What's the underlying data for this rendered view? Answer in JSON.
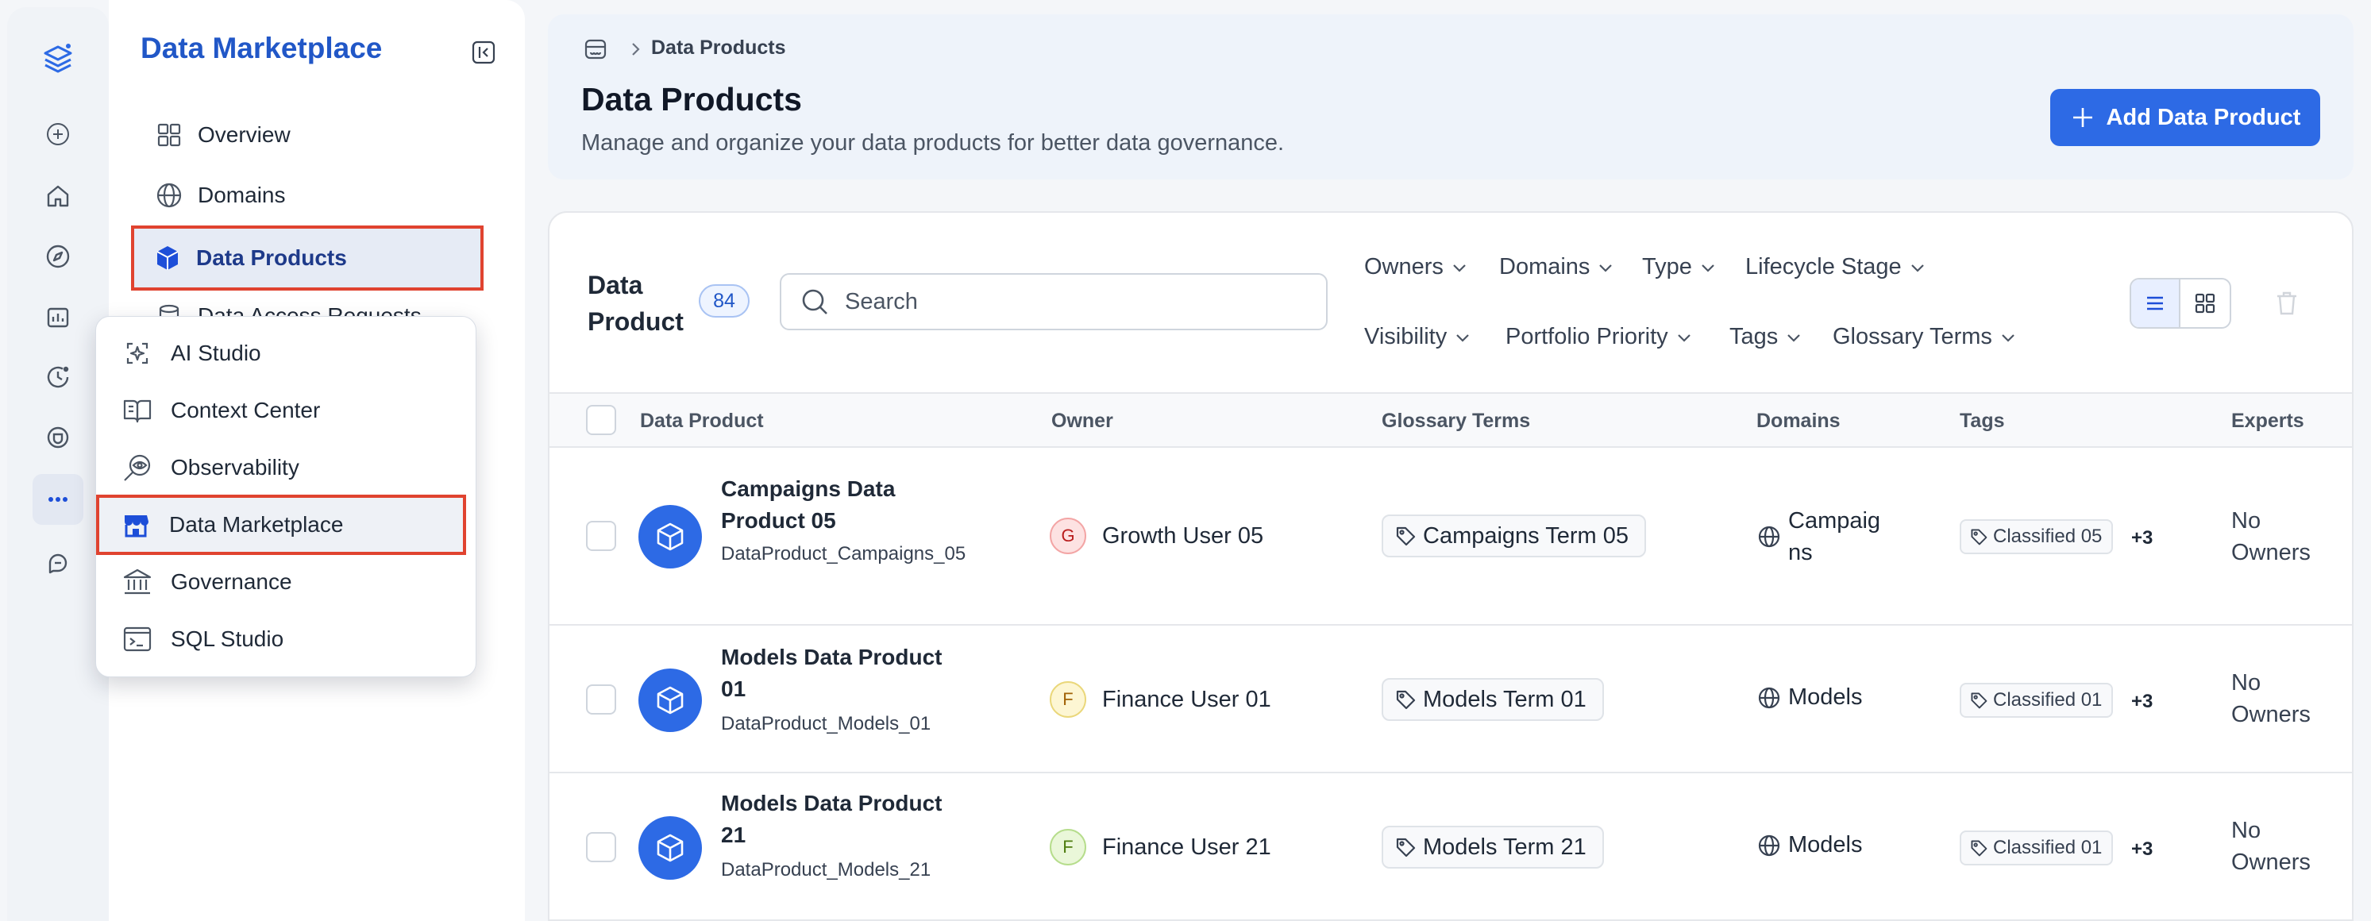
{
  "sidebar": {
    "title": "Data Marketplace",
    "items": [
      {
        "label": "Overview"
      },
      {
        "label": "Domains"
      },
      {
        "label": "Data Products"
      },
      {
        "label": "Data Access Requests"
      }
    ]
  },
  "popup_menu": {
    "items": [
      {
        "label": "AI Studio"
      },
      {
        "label": "Context Center"
      },
      {
        "label": "Observability"
      },
      {
        "label": "Data Marketplace"
      },
      {
        "label": "Governance"
      },
      {
        "label": "SQL Studio"
      }
    ]
  },
  "header": {
    "breadcrumb_current": "Data Products",
    "title": "Data Products",
    "subtitle": "Manage and organize your data products for better data governance.",
    "add_button_label": "Add Data Product"
  },
  "table": {
    "title": "Data Product",
    "count": "84",
    "search_placeholder": "Search",
    "filters": [
      "Owners",
      "Domains",
      "Type",
      "Lifecycle Stage",
      "Visibility",
      "Portfolio Priority",
      "Tags",
      "Glossary Terms"
    ],
    "columns": [
      "Data Product",
      "Owner",
      "Glossary Terms",
      "Domains",
      "Tags",
      "Experts"
    ],
    "rows": [
      {
        "name": "Campaigns Data Product 05",
        "id": "DataProduct_Campaigns_05",
        "owner_initial": "G",
        "owner": "Growth User 05",
        "glossary_term": "Campaigns Term 05",
        "domain": "Campaigns",
        "tag": "Classified 05",
        "tag_more": "+3",
        "experts": "No Owners"
      },
      {
        "name": "Models Data Product 01",
        "id": "DataProduct_Models_01",
        "owner_initial": "F",
        "owner": "Finance User 01",
        "glossary_term": "Models Term 01",
        "domain": "Models",
        "tag": "Classified 01",
        "tag_more": "+3",
        "experts": "No Owners"
      },
      {
        "name": "Models Data Product 21",
        "id": "DataProduct_Models_21",
        "owner_initial": "F",
        "owner": "Finance User 21",
        "glossary_term": "Models Term 21",
        "domain": "Models",
        "tag": "Classified 01",
        "tag_more": "+3",
        "experts": "No Owners"
      }
    ]
  },
  "colors": {
    "accent": "#2d6ae5",
    "highlight_outline": "#e04330",
    "avatar_growth_bg": "#fde2e2",
    "avatar_growth_fg": "#b91c1c",
    "avatar_finance_bg": "#fdf6d3",
    "avatar_finance_fg": "#a16207",
    "avatar_finance2_bg": "#eaf7d9",
    "avatar_finance2_fg": "#4d7c0f"
  }
}
